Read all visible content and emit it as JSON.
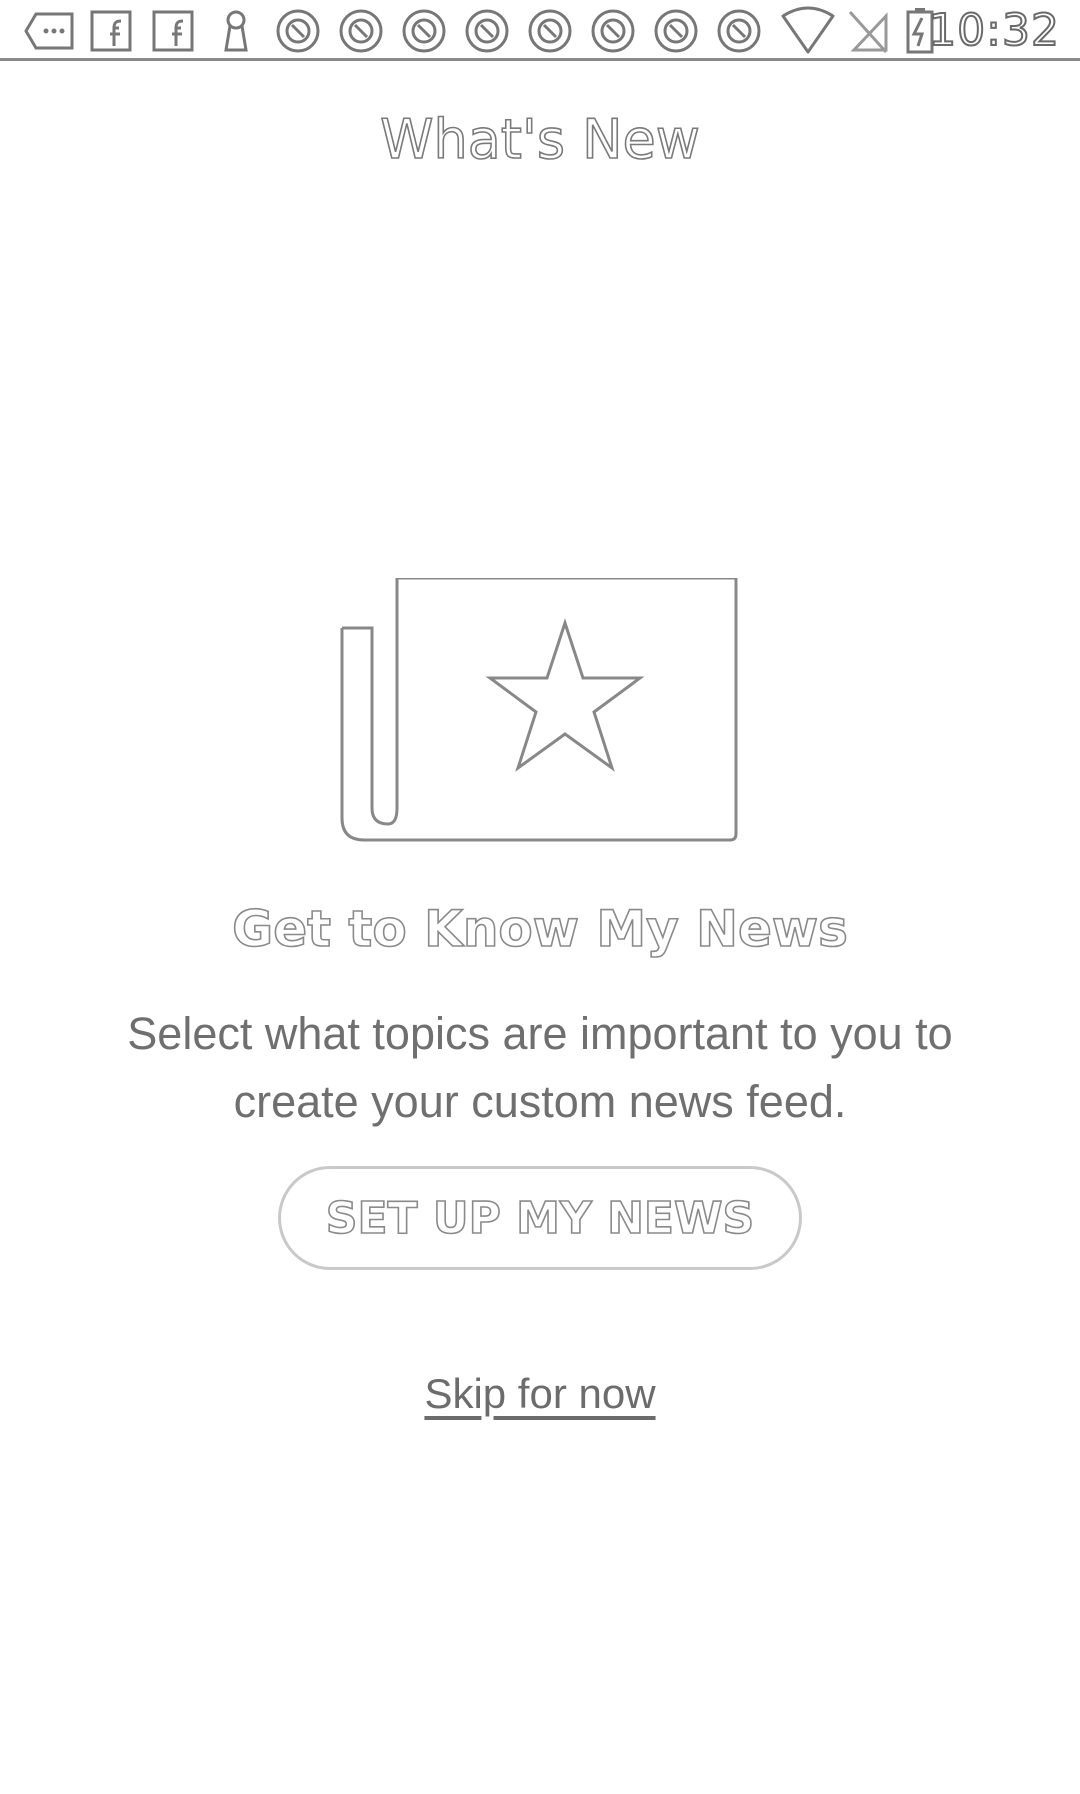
{
  "status_bar": {
    "time": "10:32",
    "icons": [
      "messages-icon",
      "facebook-icon",
      "facebook-icon",
      "keyhole-icon",
      "sync-icon",
      "sync-icon",
      "sync-icon",
      "sync-icon",
      "sync-icon",
      "sync-icon",
      "sync-icon",
      "sync-icon",
      "wifi-icon",
      "no-signal-icon",
      "battery-charging-icon"
    ]
  },
  "header": {
    "title": "What's New"
  },
  "illustration": {
    "icon": "newspaper-star-icon"
  },
  "onboarding": {
    "headline": "Get to Know My News",
    "description": "Select what topics are important to you to create your custom news feed.",
    "primary_button_label": "SET UP MY NEWS",
    "skip_label": "Skip for now"
  }
}
